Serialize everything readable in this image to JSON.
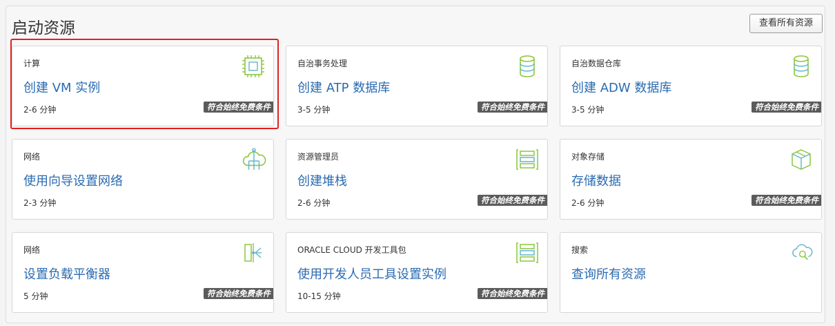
{
  "header": {
    "title": "启动资源",
    "view_all_label": "查看所有资源"
  },
  "cards": [
    {
      "category": "计算",
      "name": "创建 VM 实例",
      "time": "2-6 分钟",
      "badge": "符合始终免费条件",
      "icon": "cpu-chip-icon"
    },
    {
      "category": "自治事务处理",
      "name": "创建 ATP 数据库",
      "time": "3-5 分钟",
      "badge": "符合始终免费条件",
      "icon": "database-icon"
    },
    {
      "category": "自治数据仓库",
      "name": "创建 ADW 数据库",
      "time": "3-5 分钟",
      "badge": "符合始终免费条件",
      "icon": "database-icon"
    },
    {
      "category": "网络",
      "name": "使用向导设置网络",
      "time": "2-3 分钟",
      "badge": "",
      "icon": "cloud-network-icon"
    },
    {
      "category": "资源管理员",
      "name": "创建堆栈",
      "time": "2-6 分钟",
      "badge": "符合始终免费条件",
      "icon": "stack-icon"
    },
    {
      "category": "对象存储",
      "name": "存储数据",
      "time": "2-6 分钟",
      "badge": "符合始终免费条件",
      "icon": "storage-box-icon"
    },
    {
      "category": "网络",
      "name": "设置负载平衡器",
      "time": "5 分钟",
      "badge": "符合始终免费条件",
      "icon": "load-balancer-icon"
    },
    {
      "category": "ORACLE CLOUD 开发工具包",
      "name": "使用开发人员工具设置实例",
      "time": "10-15 分钟",
      "badge": "符合始终免费条件",
      "icon": "stack-icon"
    },
    {
      "category": "搜索",
      "name": "查询所有资源",
      "time": "",
      "badge": "",
      "icon": "cloud-search-icon"
    }
  ],
  "colors": {
    "link": "#2a6bb1",
    "icon_green": "#8cc63f",
    "icon_teal": "#5fb7c9",
    "badge_bg": "#5b5b5b",
    "highlight": "#e02020"
  }
}
